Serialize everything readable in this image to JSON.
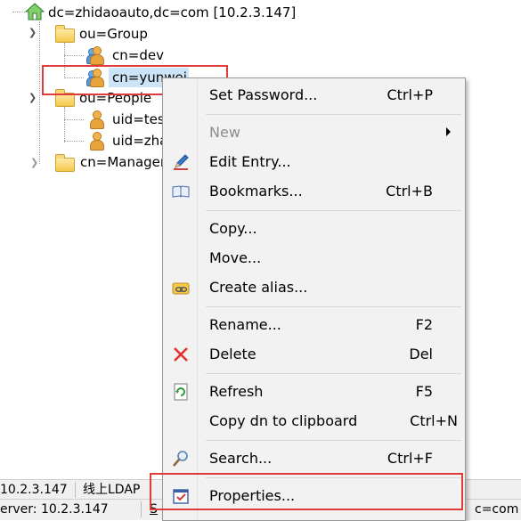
{
  "tree": {
    "root": "dc=zhidaoauto,dc=com [10.2.3.147]",
    "group_ou": "ou=Group",
    "dev": "cn=dev",
    "yunwei": "cn=yunwei",
    "people_ou": "ou=People",
    "uid1": "uid=tes",
    "uid2": "uid=zha",
    "manager": "cn=Manager"
  },
  "status": {
    "host": "10.2.3.147",
    "env": "线上LDAP",
    "server": "erver: 10.2.3.147",
    "s_char": "S",
    "dn_tail": "c=com"
  },
  "menu": {
    "items": [
      {
        "label": "Set Password...",
        "shortcut": "Ctrl+P",
        "icon": "none"
      },
      {
        "label": "New",
        "shortcut": "",
        "icon": "none",
        "disabled": true,
        "submenu": true
      },
      {
        "label": "Edit Entry...",
        "shortcut": "",
        "icon": "pencil-icon"
      },
      {
        "label": "Bookmarks...",
        "shortcut": "Ctrl+B",
        "icon": "book-icon"
      },
      {
        "label": "Copy...",
        "shortcut": "",
        "icon": "none"
      },
      {
        "label": "Move...",
        "shortcut": "",
        "icon": "none"
      },
      {
        "label": "Create alias...",
        "shortcut": "",
        "icon": "chain-folder-icon"
      },
      {
        "label": "Rename...",
        "shortcut": "F2",
        "icon": "none"
      },
      {
        "label": "Delete",
        "shortcut": "Del",
        "icon": "red-x-icon"
      },
      {
        "label": "Refresh",
        "shortcut": "F5",
        "icon": "refresh-icon"
      },
      {
        "label": "Copy dn to clipboard",
        "shortcut": "Ctrl+N",
        "icon": "none"
      },
      {
        "label": "Search...",
        "shortcut": "Ctrl+F",
        "icon": "magnifier-icon"
      },
      {
        "label": "Properties...",
        "shortcut": "",
        "icon": "properties-icon"
      }
    ]
  },
  "colors": {
    "highlight_box": "#e03a3a",
    "selection": "#cce4f7",
    "menu_bg": "#f2f2f2"
  }
}
